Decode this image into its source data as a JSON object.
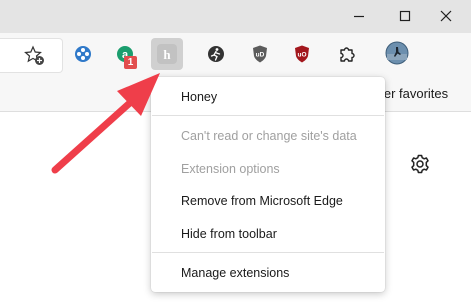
{
  "favorites_bar": {
    "label": "ther favorites"
  },
  "context_menu": {
    "items": [
      {
        "label": "Honey",
        "enabled": true
      },
      {
        "label": "Can't read or change site's data",
        "enabled": false
      },
      {
        "label": "Extension options",
        "enabled": false
      },
      {
        "label": "Remove from Microsoft Edge",
        "enabled": true
      },
      {
        "label": "Hide from toolbar",
        "enabled": true
      },
      {
        "label": "Manage extensions",
        "enabled": true
      }
    ]
  },
  "badges": {
    "extension_badge_count": "1"
  },
  "colors": {
    "arrow": "#ef3e4a",
    "badge": "#e24e4e",
    "ublock": "#a3171d",
    "titlebar": "#e4e4e4",
    "toolbar": "#f7f7f7"
  },
  "icons": {
    "window_controls": [
      "minimize-icon",
      "maximize-icon",
      "close-icon"
    ],
    "toolbar": [
      "add-favorite-icon",
      "extension-blue-icon",
      "extension-green-icon",
      "honey-extension-icon",
      "extension-runner-icon",
      "ublock-gray-icon",
      "ublock-red-icon",
      "extensions-puzzle-icon",
      "profile-avatar"
    ],
    "page": [
      "settings-gear-icon"
    ]
  }
}
